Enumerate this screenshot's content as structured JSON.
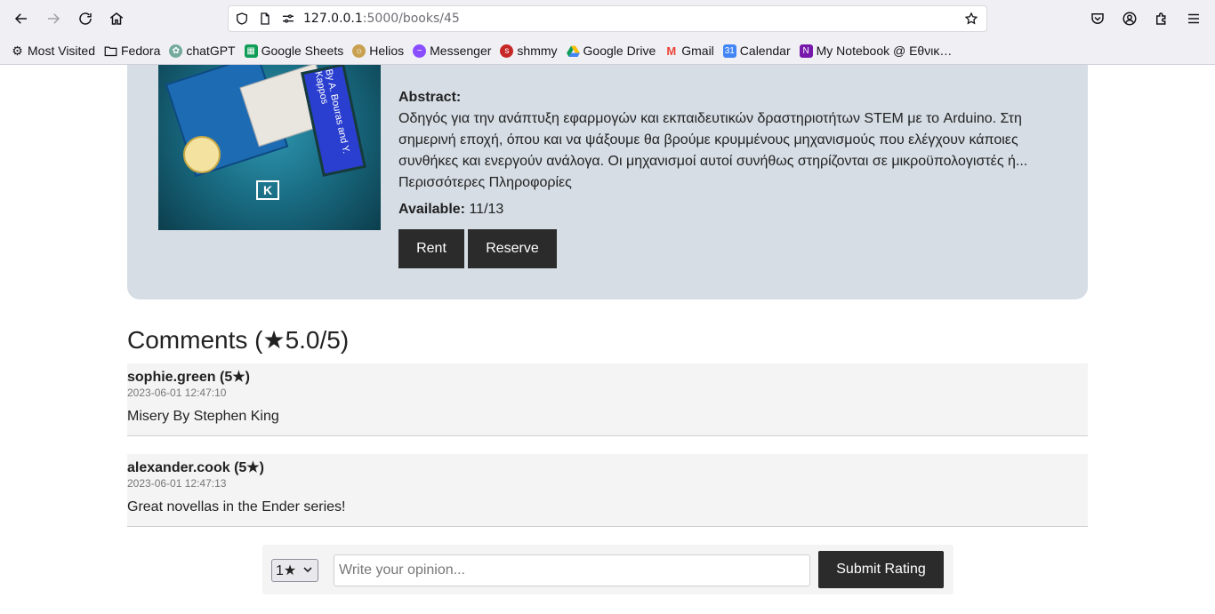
{
  "browser": {
    "url_host": "127.0.0.1",
    "url_path": ":5000/books/45",
    "bookmarks": [
      {
        "label": "Most Visited",
        "icon": "gear-icon"
      },
      {
        "label": "Fedora",
        "icon": "folder-icon"
      },
      {
        "label": "chatGPT",
        "icon": "chatgpt-icon"
      },
      {
        "label": "Google Sheets",
        "icon": "sheets-icon"
      },
      {
        "label": "Helios",
        "icon": "helios-icon"
      },
      {
        "label": "Messenger",
        "icon": "messenger-icon"
      },
      {
        "label": "shmmy",
        "icon": "shmmy-icon"
      },
      {
        "label": "Google Drive",
        "icon": "drive-icon"
      },
      {
        "label": "Gmail",
        "icon": "gmail-icon"
      },
      {
        "label": "Calendar",
        "icon": "calendar-icon"
      },
      {
        "label": "My Notebook @ Εθνικ…",
        "icon": "onenote-icon"
      }
    ]
  },
  "book": {
    "cover_text": "By A. Bouras and Y. Kappos",
    "cover_logo": "K",
    "abstract_label": "Abstract:",
    "abstract_text": "Οδηγός για την ανάπτυξη εφαρμογών και εκπαιδευτικών δραστηριοτήτων STEM με το Arduino. Στη σημερινή εποχή, όπου και να ψάξουμε θα βρούμε κρυμμένους μηχανισμούς που ελέγχουν κάποιες συνθήκες και ενεργούν ανάλογα. Οι μηχανισμοί αυτοί συνήθως στηρίζονται σε μικροϋπολογιστές ή...",
    "more_link": "Περισσότερες Πληροφορίες",
    "available_label": "Available:",
    "available_value": "11/13",
    "rent_label": "Rent",
    "reserve_label": "Reserve"
  },
  "comments": {
    "title": "Comments (★5.0/5)",
    "items": [
      {
        "author": "sophie.green (5★)",
        "date": "2023-06-01 12:47:10",
        "text": "Misery By Stephen King"
      },
      {
        "author": "alexander.cook (5★)",
        "date": "2023-06-01 12:47:13",
        "text": "Great novellas in the Ender series!"
      }
    ]
  },
  "rating_form": {
    "selected": "1★",
    "placeholder": "Write your opinion...",
    "submit_label": "Submit Rating"
  }
}
